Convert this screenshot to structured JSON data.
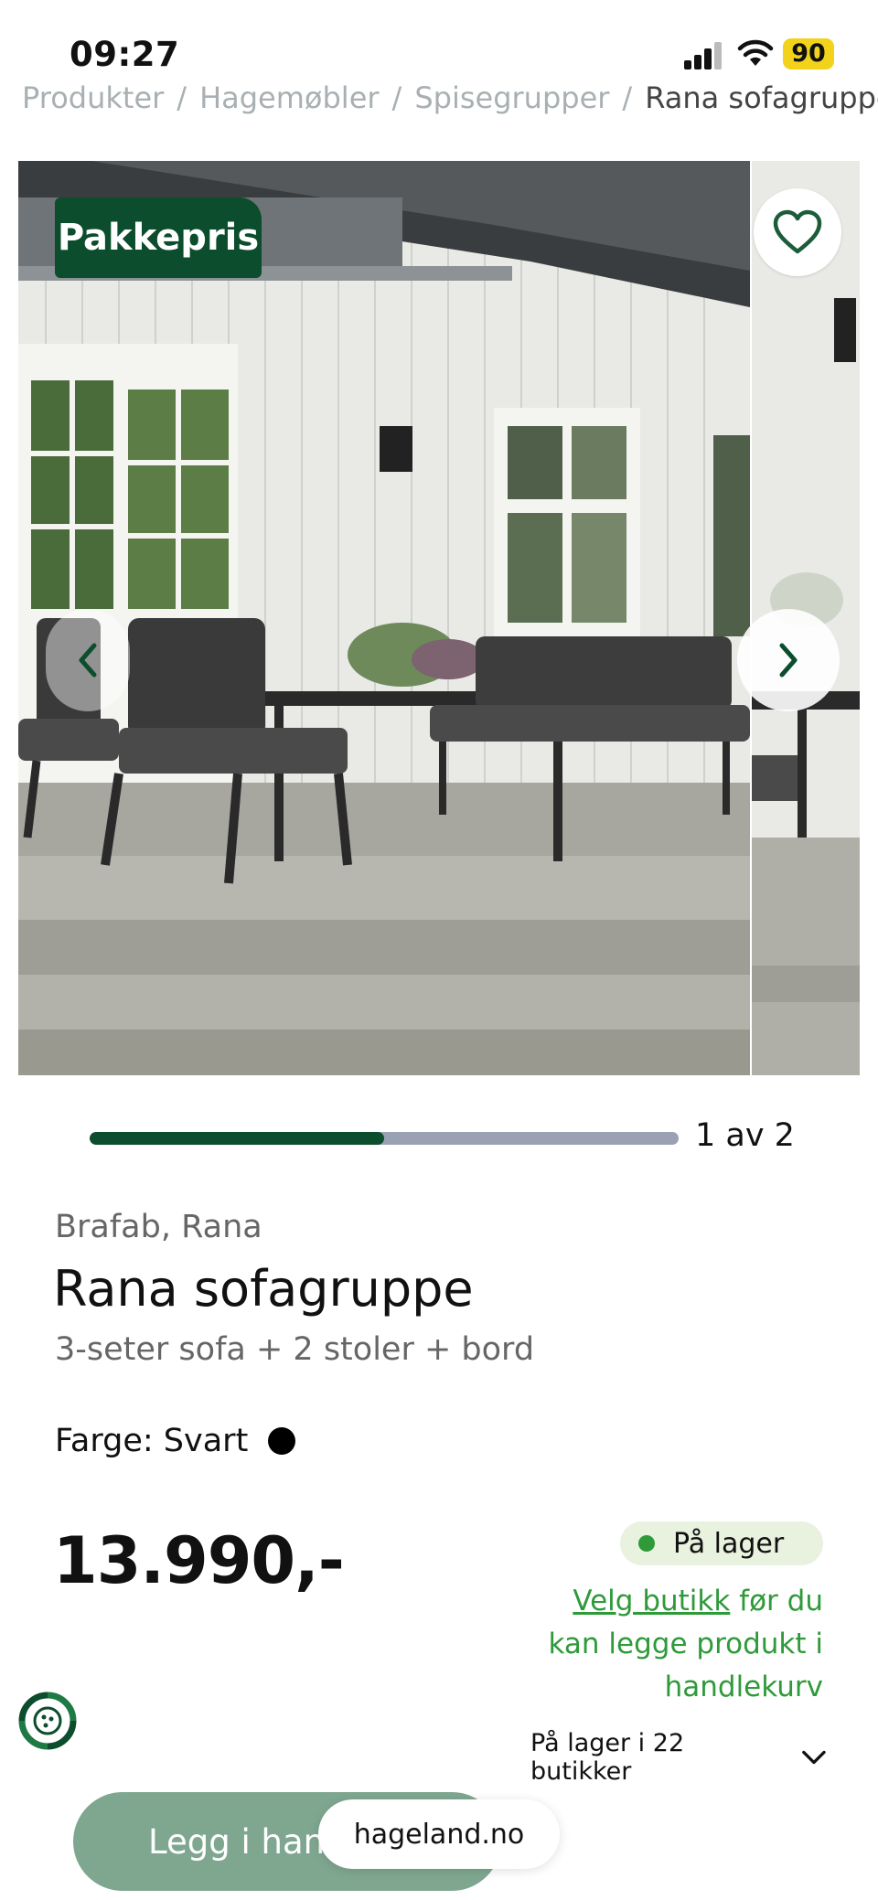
{
  "status_bar": {
    "time": "09:27",
    "battery": "90"
  },
  "breadcrumb": [
    "Produkter",
    "Hagemøbler",
    "Spisegrupper",
    "Rana sofagruppe"
  ],
  "carousel": {
    "badge": "Pakkepris",
    "position_label": "1 av 2",
    "progress_fraction": 0.5
  },
  "product": {
    "brand": "Brafab, Rana",
    "title": "Rana sofagruppe",
    "subtitle": "3-seter sofa + 2 stoler + bord",
    "color_label": "Farge: Svart",
    "price": "13.990,-",
    "stock_status": "På lager",
    "store_link": "Velg butikk",
    "store_note_rest": " før du kan legge produkt i handlekurv",
    "stores_label": "På lager i 22 butikker"
  },
  "actions": {
    "add_to_cart": "Legg i handlekurv"
  },
  "browser": {
    "domain": "hageland.no"
  },
  "colors": {
    "brand_green": "#0b4d2c",
    "accent_green": "#2f9a3a",
    "button_green": "#7fa790"
  }
}
